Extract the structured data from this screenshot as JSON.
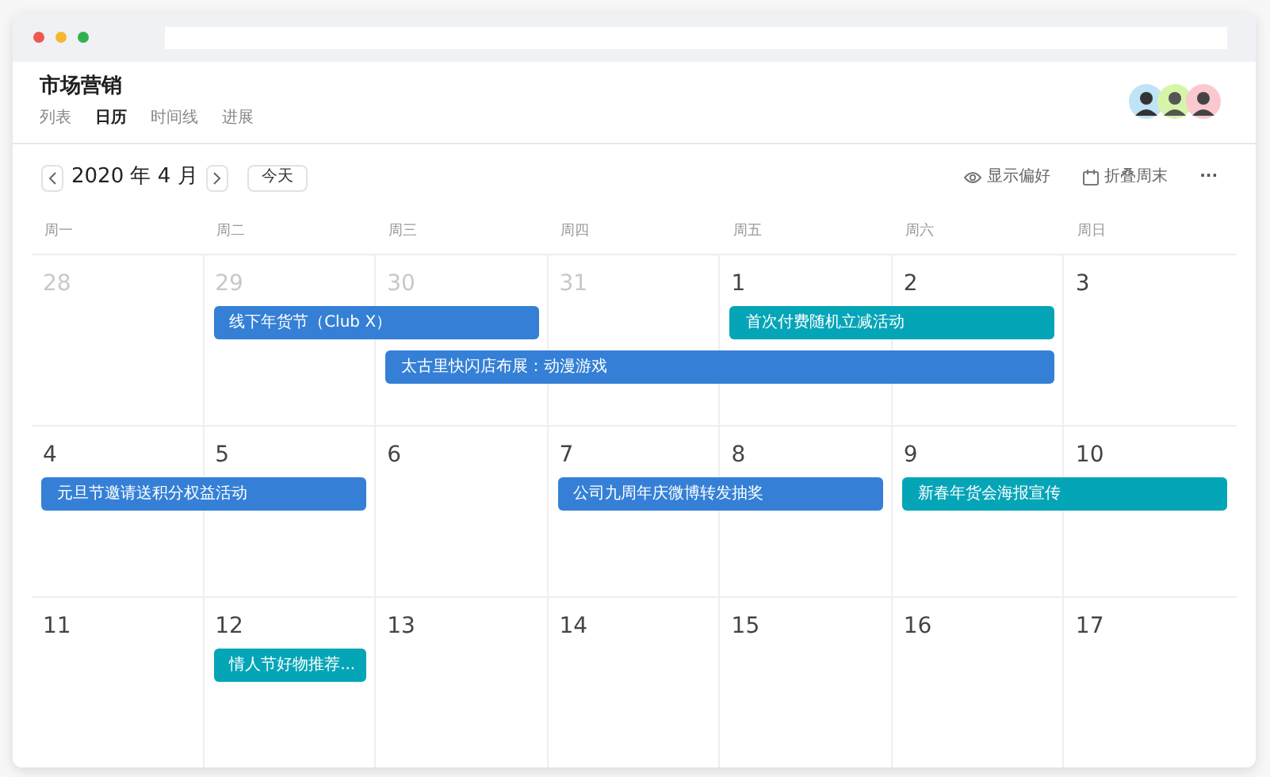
{
  "project": {
    "title": "市场营销"
  },
  "tabs": [
    {
      "label": "列表",
      "selected": false
    },
    {
      "label": "日历",
      "selected": true
    },
    {
      "label": "时间线",
      "selected": false
    },
    {
      "label": "进展",
      "selected": false
    }
  ],
  "toolbar": {
    "period": "2020 年 4 月",
    "today_button": "今天",
    "actions": [
      {
        "kind": "eye",
        "label": "显示偏好"
      },
      {
        "kind": "calendar",
        "label": "折叠周末"
      },
      {
        "kind": "more",
        "label": "···"
      }
    ]
  },
  "weekdays": [
    "周一",
    "周二",
    "周三",
    "周四",
    "周五",
    "周六",
    "周日"
  ],
  "weeks": [
    {
      "days": [
        {
          "label": "28",
          "muted": true
        },
        {
          "label": "29",
          "muted": true
        },
        {
          "label": "30",
          "muted": true
        },
        {
          "label": "31",
          "muted": true
        },
        {
          "label": "1",
          "muted": false
        },
        {
          "label": "2",
          "muted": false
        },
        {
          "label": "3",
          "muted": false
        }
      ],
      "lanes": [
        [
          {
            "title": "线下年货节（Club X）",
            "color": "#3580d6"
          },
          {
            "title": "首次付费随机立减活动",
            "color": "#05a5b8"
          }
        ],
        [
          {
            "title": "太古里快闪店布展：动漫游戏",
            "color": "#3580d6"
          }
        ]
      ]
    },
    {
      "days": [
        {
          "label": "4",
          "muted": false
        },
        {
          "label": "5",
          "muted": false
        },
        {
          "label": "6",
          "muted": false
        },
        {
          "label": "7",
          "muted": false
        },
        {
          "label": "8",
          "muted": false
        },
        {
          "label": "9",
          "muted": false
        },
        {
          "label": "10",
          "muted": false
        }
      ],
      "lanes": [
        [
          {
            "title": "元旦节邀请送积分权益活动",
            "color": "#3580d6"
          },
          {
            "title": "公司九周年庆微博转发抽奖",
            "color": "#3580d6"
          },
          {
            "title": "新春年货会海报宣传",
            "color": "#05a5b8"
          }
        ]
      ]
    },
    {
      "days": [
        {
          "label": "11",
          "muted": false
        },
        {
          "label": "12",
          "muted": false
        },
        {
          "label": "13",
          "muted": false
        },
        {
          "label": "14",
          "muted": false
        },
        {
          "label": "15",
          "muted": false
        },
        {
          "label": "16",
          "muted": false
        },
        {
          "label": "17",
          "muted": false
        }
      ],
      "lanes": [
        [
          {
            "title": "情人节好物推荐...",
            "color": "#05a5b8"
          }
        ]
      ]
    }
  ]
}
